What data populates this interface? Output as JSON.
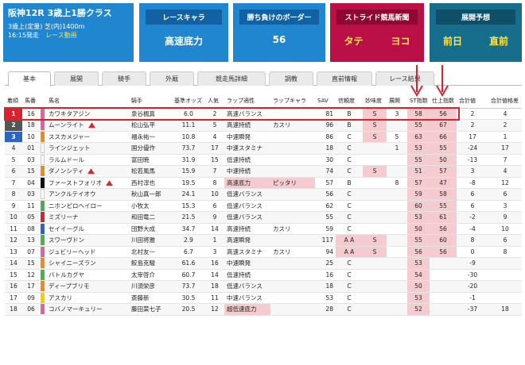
{
  "race": {
    "title": "阪神12R 3歳上1勝クラス",
    "info": "3歳上(定量) 芝(内)1400m",
    "time": "16:15発走",
    "video": "レース動画"
  },
  "boxes": {
    "chara": {
      "caption": "レースキャラ",
      "value": "高速底力"
    },
    "border": {
      "caption": "勝ち負けのボーダー",
      "value": "56"
    },
    "stride": {
      "caption": "ストライド競馬新聞",
      "left": "タテ",
      "right": "ヨコ"
    },
    "forecast": {
      "caption": "展開予想",
      "left": "前日",
      "right": "直前"
    }
  },
  "tabs": [
    "基本",
    "展開",
    "騎手",
    "外厩",
    "競走馬詳細",
    "調教",
    "直前情報",
    "レース結果"
  ],
  "columns": [
    "着順",
    "馬番",
    "馬名",
    "騎手",
    "基準オッズ",
    "人気",
    "ラップ適性",
    "ラップキャラ",
    "SAV",
    "信頼度",
    "妙味度",
    "展開",
    "ST指数",
    "仕上指数",
    "合計値",
    "合計値格差"
  ],
  "colors": {
    "highlight": "#f4cccf",
    "frame": "#d8232e",
    "tab_active": "#ffffff"
  },
  "rows": [
    {
      "rank": "1",
      "num": "16",
      "color": "#e5609d",
      "name": "カワキタアジン",
      "jockey": "泉谷楓真",
      "odds": "6.0",
      "pop": "2",
      "lap": "高速バランス",
      "chara": "",
      "sav": "81",
      "rel": "B",
      "myomi": "S",
      "tenkai": "3",
      "st": "58",
      "shiage": "56",
      "total": "2",
      "gap": "4",
      "icon": false
    },
    {
      "rank": "2",
      "num": "18",
      "color": "#e5609d",
      "name": "ムーンライト",
      "jockey": "松山弘平",
      "odds": "11.1",
      "pop": "5",
      "lap": "高速持続",
      "chara": "カスリ",
      "sav": "96",
      "rel": "B",
      "myomi": "S",
      "tenkai": "",
      "st": "55",
      "shiage": "67",
      "total": "2",
      "gap": "2",
      "icon": true
    },
    {
      "rank": "3",
      "num": "10",
      "color": "#f08a1f",
      "name": "ススカメジャー",
      "jockey": "福永祐一",
      "odds": "10.8",
      "pop": "4",
      "lap": "中速瞬発",
      "chara": "",
      "sav": "86",
      "rel": "C",
      "myomi": "S",
      "tenkai": "5",
      "st": "63",
      "shiage": "66",
      "total": "17",
      "gap": "1",
      "icon": false
    },
    {
      "rank": "4",
      "num": "01",
      "color": "#ffffff",
      "name": "ラインジェット",
      "jockey": "国分優作",
      "odds": "73.7",
      "pop": "17",
      "lap": "中速スタミナ",
      "chara": "",
      "sav": "18",
      "rel": "C",
      "myomi": "",
      "tenkai": "1",
      "st": "53",
      "shiage": "55",
      "total": "-24",
      "gap": "17",
      "icon": false
    },
    {
      "rank": "5",
      "num": "03",
      "color": "#ffffff",
      "name": "ラルムドール",
      "jockey": "富田暁",
      "odds": "31.9",
      "pop": "15",
      "lap": "低速持続",
      "chara": "",
      "sav": "30",
      "rel": "C",
      "myomi": "",
      "tenkai": "",
      "st": "55",
      "shiage": "50",
      "total": "-13",
      "gap": "7",
      "icon": false
    },
    {
      "rank": "6",
      "num": "15",
      "color": "#f08a1f",
      "name": "ダノンシティ",
      "jockey": "松若風馬",
      "odds": "15.9",
      "pop": "7",
      "lap": "中速持続",
      "chara": "",
      "sav": "74",
      "rel": "C",
      "myomi": "S",
      "tenkai": "",
      "st": "51",
      "shiage": "57",
      "total": "3",
      "gap": "4",
      "icon": true
    },
    {
      "rank": "7",
      "num": "04",
      "color": "#111111",
      "name": "ファーストフォリオ",
      "jockey": "西村淳也",
      "odds": "19.5",
      "pop": "8",
      "lap": "高速底力",
      "chara": "ピッタリ",
      "sav": "57",
      "rel": "B",
      "myomi": "",
      "tenkai": "8",
      "st": "57",
      "shiage": "47",
      "total": "-8",
      "gap": "12",
      "icon": true
    },
    {
      "rank": "8",
      "num": "03",
      "color": "#ffffff",
      "name": "アンクルテイオウ",
      "jockey": "秋山真一郎",
      "odds": "24.1",
      "pop": "10",
      "lap": "低速バランス",
      "chara": "",
      "sav": "56",
      "rel": "C",
      "myomi": "",
      "tenkai": "",
      "st": "59",
      "shiage": "58",
      "total": "6",
      "gap": "6",
      "icon": false
    },
    {
      "rank": "9",
      "num": "11",
      "color": "#4caf50",
      "name": "ニホンピロヘイロー",
      "jockey": "小牧太",
      "odds": "15.3",
      "pop": "6",
      "lap": "低速バランス",
      "chara": "",
      "sav": "62",
      "rel": "C",
      "myomi": "",
      "tenkai": "",
      "st": "60",
      "shiage": "55",
      "total": "6",
      "gap": "3",
      "icon": false
    },
    {
      "rank": "10",
      "num": "05",
      "color": "#d8232e",
      "name": "ミズリーナ",
      "jockey": "和田竜二",
      "odds": "21.5",
      "pop": "9",
      "lap": "低速バランス",
      "chara": "",
      "sav": "55",
      "rel": "C",
      "myomi": "",
      "tenkai": "",
      "st": "53",
      "shiage": "61",
      "total": "-2",
      "gap": "9",
      "icon": false
    },
    {
      "rank": "11",
      "num": "08",
      "color": "#2f63c0",
      "name": "セイイーグル",
      "jockey": "団野大成",
      "odds": "34.7",
      "pop": "14",
      "lap": "高速持続",
      "chara": "カスリ",
      "sav": "59",
      "rel": "C",
      "myomi": "",
      "tenkai": "",
      "st": "50",
      "shiage": "56",
      "total": "-4",
      "gap": "10",
      "icon": false
    },
    {
      "rank": "12",
      "num": "13",
      "color": "#4caf50",
      "name": "スワーヴドン",
      "jockey": "川田将雅",
      "odds": "2.9",
      "pop": "1",
      "lap": "高速瞬発",
      "chara": "",
      "sav": "117",
      "rel": "A A",
      "myomi": "S",
      "tenkai": "",
      "st": "55",
      "shiage": "60",
      "total": "8",
      "gap": "6",
      "icon": false
    },
    {
      "rank": "13",
      "num": "07",
      "color": "#e5609d",
      "name": "ジュビリーヘッド",
      "jockey": "北村友一",
      "odds": "6.7",
      "pop": "3",
      "lap": "高速スタミナ",
      "chara": "カスリ",
      "sav": "94",
      "rel": "A A",
      "myomi": "S",
      "tenkai": "",
      "st": "56",
      "shiage": "56",
      "total": "0",
      "gap": "8",
      "icon": false
    },
    {
      "rank": "14",
      "num": "15",
      "color": "#f08a1f",
      "name": "シャイニーズラン",
      "jockey": "鮫島克駿",
      "odds": "61.6",
      "pop": "16",
      "lap": "中速瞬発",
      "chara": "",
      "sav": "25",
      "rel": "C",
      "myomi": "",
      "tenkai": "",
      "st": "53",
      "shiage": "",
      "total": "-9",
      "gap": "",
      "icon": false
    },
    {
      "rank": "15",
      "num": "12",
      "color": "#4caf50",
      "name": "バトルカグヤ",
      "jockey": "太宰啓介",
      "odds": "60.7",
      "pop": "14",
      "lap": "低速持続",
      "chara": "",
      "sav": "16",
      "rel": "C",
      "myomi": "",
      "tenkai": "",
      "st": "54",
      "shiage": "",
      "total": "-30",
      "gap": "",
      "icon": false
    },
    {
      "rank": "16",
      "num": "17",
      "color": "#f08a1f",
      "name": "ディープブリモ",
      "jockey": "川須栄彦",
      "odds": "73.7",
      "pop": "18",
      "lap": "低速バランス",
      "chara": "",
      "sav": "18",
      "rel": "C",
      "myomi": "",
      "tenkai": "",
      "st": "50",
      "shiage": "",
      "total": "-20",
      "gap": "",
      "icon": false
    },
    {
      "rank": "17",
      "num": "09",
      "color": "#f5d000",
      "name": "アスカリ",
      "jockey": "斎藤新",
      "odds": "30.5",
      "pop": "11",
      "lap": "中速バランス",
      "chara": "",
      "sav": "53",
      "rel": "C",
      "myomi": "",
      "tenkai": "",
      "st": "53",
      "shiage": "",
      "total": "-1",
      "gap": "",
      "icon": false
    },
    {
      "rank": "18",
      "num": "06",
      "color": "#e5609d",
      "name": "コバノマーキュリー",
      "jockey": "藤田菜七子",
      "odds": "20.5",
      "pop": "12",
      "lap": "超低速底力",
      "chara": "",
      "sav": "28",
      "rel": "C",
      "myomi": "",
      "tenkai": "",
      "st": "52",
      "shiage": "",
      "total": "-37",
      "gap": "18",
      "icon": false
    }
  ]
}
